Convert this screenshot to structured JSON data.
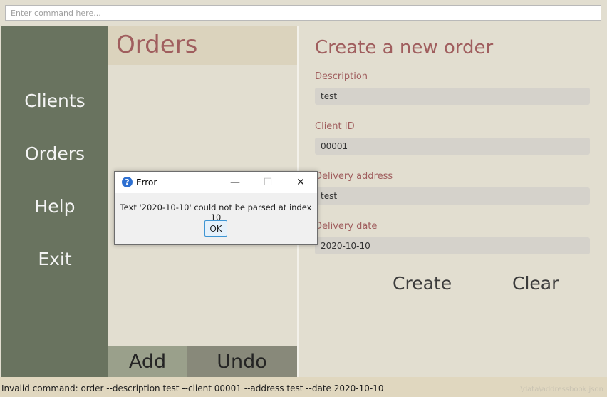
{
  "command_bar": {
    "placeholder": "Enter command here..."
  },
  "sidebar": {
    "items": [
      {
        "label": "Clients"
      },
      {
        "label": "Orders"
      },
      {
        "label": "Help"
      },
      {
        "label": "Exit"
      }
    ]
  },
  "orders_panel": {
    "title": "Orders",
    "add_label": "Add",
    "undo_label": "Undo"
  },
  "create_form": {
    "title": "Create a new order",
    "fields": [
      {
        "label": "Description",
        "value": "test"
      },
      {
        "label": "Client ID",
        "value": "00001"
      },
      {
        "label": "Delivery address",
        "value": "test"
      },
      {
        "label": "Delivery date",
        "value": "2020-10-10"
      }
    ],
    "create_label": "Create",
    "clear_label": "Clear"
  },
  "status_bar": {
    "message": "Invalid command: order --description test --client 00001 --address test --date 2020-10-10",
    "file_path": ".\\data\\addressbook.json"
  },
  "error_dialog": {
    "title": "Error",
    "icon": "question-icon",
    "message": "Text '2020-10-10' could not be parsed at index 10",
    "ok_label": "OK",
    "minimize_glyph": "—",
    "maximize_glyph": "☐",
    "close_glyph": "✕"
  },
  "colors": {
    "sidebar": "#69735f",
    "accent_text": "#a05e5e",
    "panel_background": "#e2ded0",
    "header_background": "#dbd3bd",
    "add_button": "#9aa08b",
    "undo_button": "#88897a"
  }
}
